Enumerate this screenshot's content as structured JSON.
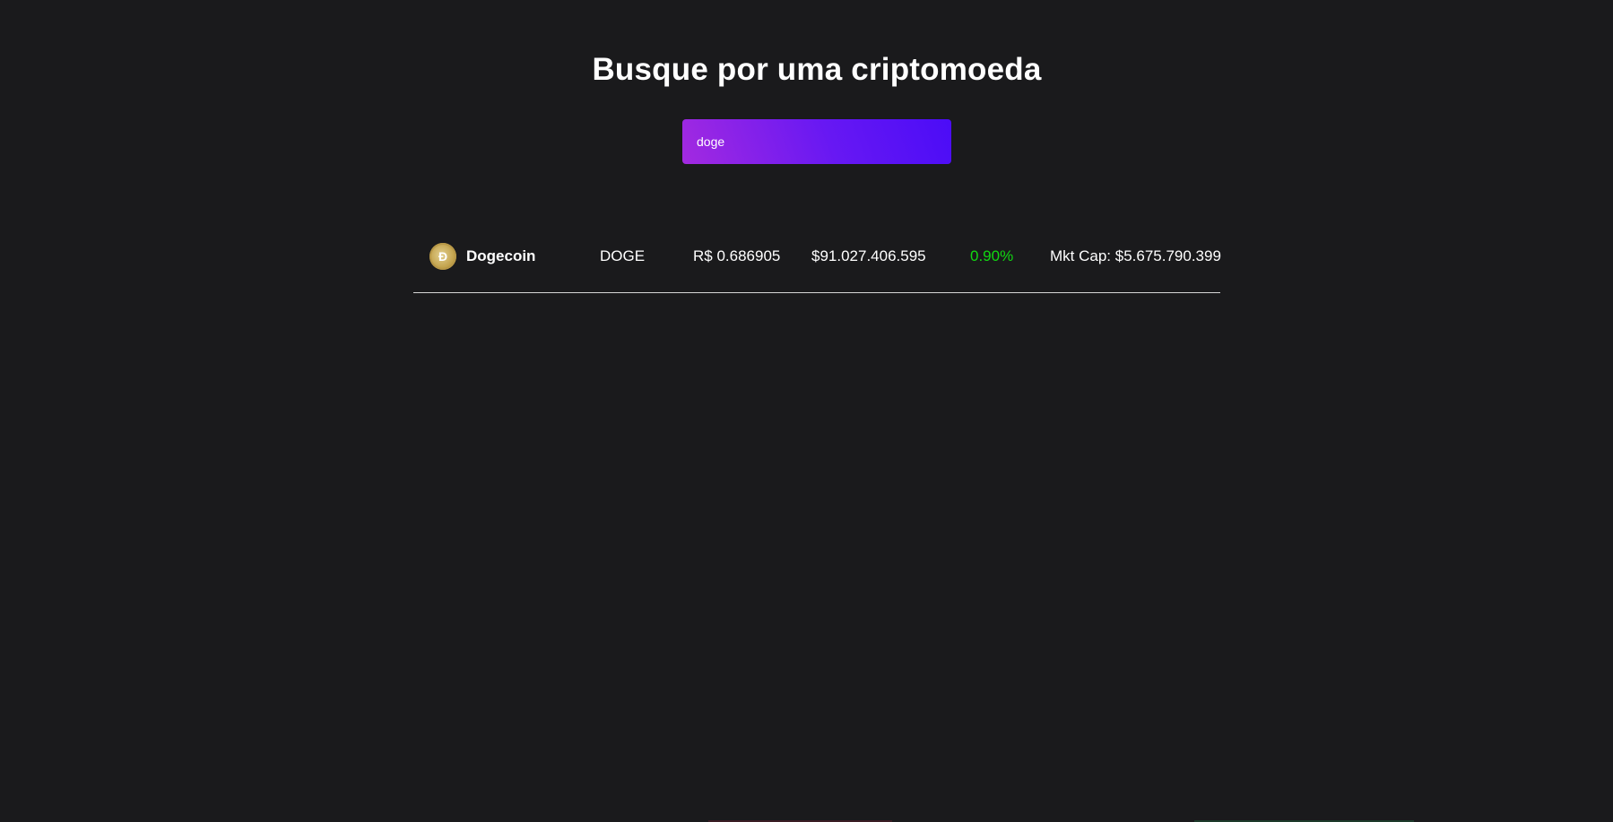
{
  "header": {
    "title": "Busque por uma criptomoeda"
  },
  "search": {
    "value": "doge",
    "placeholder": ""
  },
  "coins": [
    {
      "name": "Dogecoin",
      "symbol": "DOGE",
      "price": "R$ 0.686905",
      "volume": "$91.027.406.595",
      "change": "0.90%",
      "market_cap": "Mkt Cap: $5.675.790.399",
      "logo_icon": "dogecoin-icon",
      "change_color": "#11d811"
    }
  ],
  "colors": {
    "background": "#1a1a1c",
    "search_gradient_start": "#a32ae0",
    "search_gradient_end": "#4b0cf7",
    "positive": "#11d811"
  }
}
